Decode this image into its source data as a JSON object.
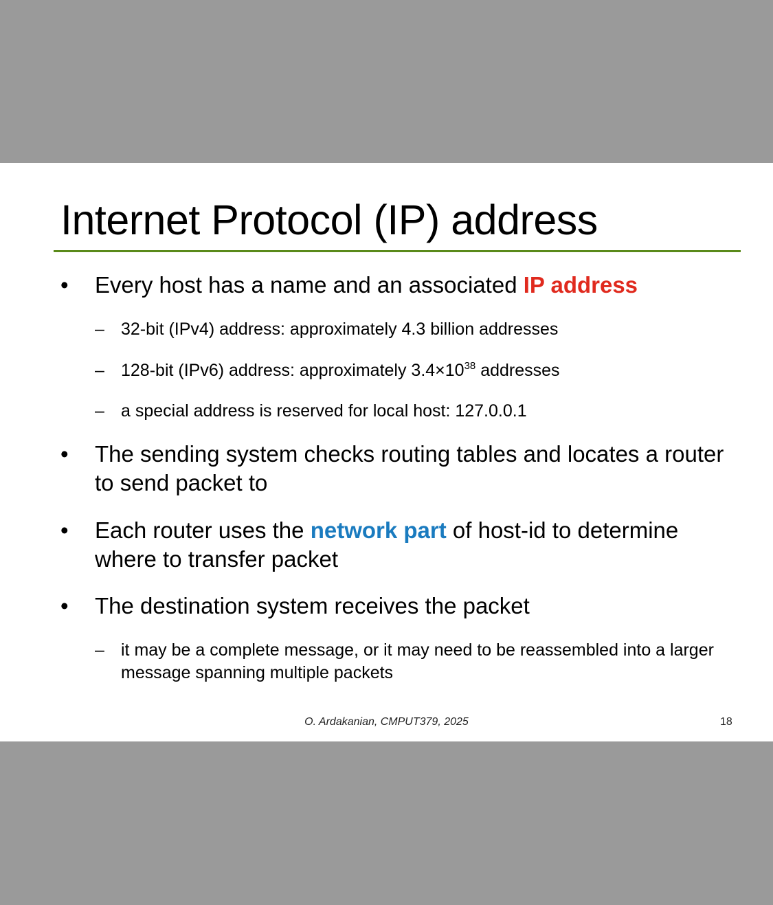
{
  "title": "Internet Protocol (IP) address",
  "bullets": [
    {
      "before": "Every host has a name and an associated ",
      "highlight": "IP address",
      "highlight_color": "#e02a1e"
    },
    {
      "text": "The sending system checks routing tables and locates a router to send packet to"
    },
    {
      "before": "Each router uses the ",
      "highlight": "network part",
      "highlight_color": "#1a7bbf",
      "after": " of host-id to determine where to transfer packet"
    },
    {
      "text": "The destination system receives the packet"
    }
  ],
  "sub_bullets": {
    "ipv4": "32-bit (IPv4) address: approximately 4.3 billion addresses",
    "ipv6_before": "128-bit (IPv6) address: approximately 3.4×10",
    "ipv6_exp": "38",
    "ipv6_after": " addresses",
    "localhost": "a special address is reserved for local host: 127.0.0.1",
    "reassembly": "it may be a complete message, or it may need to be reassembled into a larger message spanning multiple packets"
  },
  "bullet_symbol": "•",
  "dash_symbol": "–",
  "footer": "O. Ardakanian, CMPUT379, 2025",
  "page_number": "18",
  "colors": {
    "rule": "#5a8a1a",
    "background": "#9a9a9a",
    "slide": "#ffffff"
  }
}
